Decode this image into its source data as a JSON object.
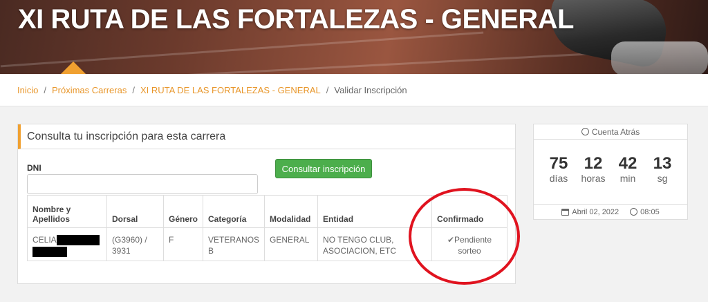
{
  "hero": {
    "title": "XI RUTA DE LAS FORTALEZAS - GENERAL"
  },
  "breadcrumb": {
    "items": [
      "Inicio",
      "Próximas Carreras",
      "XI RUTA DE LAS FORTALEZAS - GENERAL"
    ],
    "current": "Validar Inscripción",
    "separator": "/"
  },
  "consulta": {
    "title": "Consulta tu inscripción para esta carrera",
    "dni_label": "DNI",
    "dni_value": "",
    "button": "Consultar inscripción"
  },
  "table": {
    "headers": [
      "Nombre y Apellidos",
      "Dorsal",
      "Género",
      "Categoría",
      "Modalidad",
      "Entidad",
      "Confirmado"
    ],
    "row": {
      "nombre": "CELIA",
      "dorsal": "(G3960) / 3931",
      "genero": "F",
      "categoria": "VETERANOS B",
      "modalidad": "GENERAL",
      "entidad": "NO TENGO CLUB, ASOCIACION, ETC",
      "confirmado": "Pendiente sorteo"
    }
  },
  "countdown": {
    "title": "Cuenta Atrás",
    "days": "75",
    "days_label": "días",
    "hours": "12",
    "hours_label": "horas",
    "minutes": "42",
    "minutes_label": "min",
    "seconds": "13",
    "seconds_label": "sg",
    "date": "Abril 02, 2022",
    "time": "08:05"
  },
  "colors": {
    "accent": "#f0a030",
    "link": "#e8962a",
    "button": "#4cae4c",
    "annotation": "#e0131f"
  }
}
